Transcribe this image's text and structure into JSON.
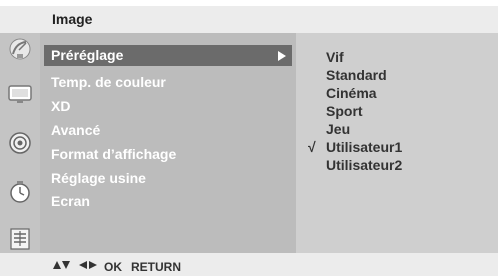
{
  "title": "Image",
  "menu": {
    "items": [
      {
        "label": "Préréglage",
        "selected": true
      },
      {
        "label": "Temp. de couleur"
      },
      {
        "label": "XD"
      },
      {
        "label": "Avancé"
      },
      {
        "label": "Format d’affichage"
      },
      {
        "label": "Réglage usine"
      },
      {
        "label": "Ecran"
      }
    ]
  },
  "submenu": {
    "items": [
      {
        "label": "Vif"
      },
      {
        "label": "Standard"
      },
      {
        "label": "Cinéma"
      },
      {
        "label": "Sport"
      },
      {
        "label": "Jeu"
      },
      {
        "label": "Utilisateur1",
        "checked": true,
        "check_mark": "√"
      },
      {
        "label": "Utilisateur2"
      }
    ]
  },
  "hints": {
    "ok": "OK",
    "return": "RETURN"
  },
  "icons": [
    "satellite-dish-icon",
    "tv-screen-icon",
    "speaker-icon",
    "clock-icon",
    "settings-list-icon"
  ],
  "colors": {
    "selected_bg": "#6b6b6b",
    "menu_bg": "#bcbcbc",
    "submenu_bg": "#cfcfcf",
    "icon_column_bg": "#c4c4c4"
  }
}
